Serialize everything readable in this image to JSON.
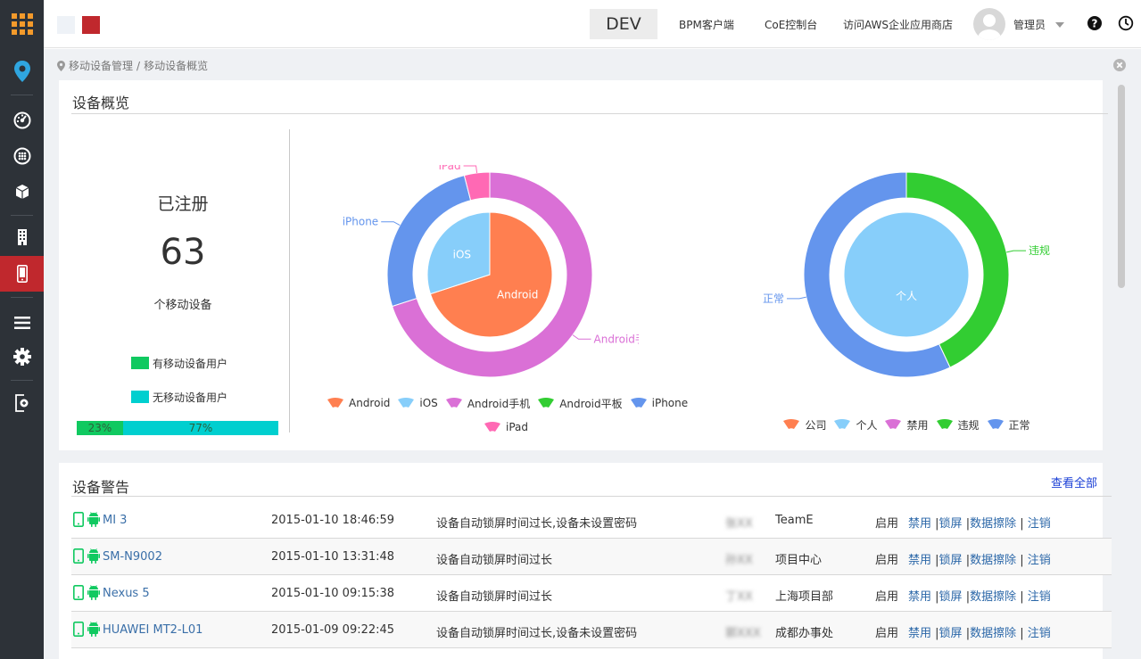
{
  "colors": {
    "sidebar_bg": "#2d3238",
    "sidebar_active": "#c0282d",
    "accent_orange": "#f39a2b",
    "android": "#ff7f50",
    "ios": "#87cefa",
    "android_phone": "#da70d6",
    "android_tablet": "#32cd32",
    "iphone": "#6495ed",
    "ipad": "#ff69b4",
    "green_bar": "#10c960",
    "cyan_bar": "#00cfcf"
  },
  "sidebar": {
    "items": [
      {
        "icon": "location-pin-icon"
      },
      {
        "icon": "dashboard-icon"
      },
      {
        "icon": "globe-grid-icon"
      },
      {
        "icon": "cube-icon"
      },
      {
        "icon": "building-icon"
      },
      {
        "icon": "mobile-device-icon",
        "active": true
      },
      {
        "icon": "menu-lines-icon"
      },
      {
        "icon": "gear-icon"
      },
      {
        "icon": "logout-icon"
      }
    ]
  },
  "topbar": {
    "env": "DEV",
    "links": [
      "BPM客户端",
      "CoE控制台",
      "访问AWS企业应用商店"
    ],
    "username": "管理员",
    "help_icon": "help-circle-icon",
    "clock_icon": "clock-icon"
  },
  "breadcrumb": {
    "parts": [
      "移动设备管理",
      "/",
      "移动设备概览"
    ]
  },
  "overview": {
    "title": "设备概览",
    "registered_label": "已注册",
    "count": "63",
    "unit": "个移动设备",
    "legend": [
      {
        "label": "有移动设备用户",
        "color": "#10c960"
      },
      {
        "label": "无移动设备用户",
        "color": "#00cfcf"
      }
    ],
    "bar": [
      {
        "label": "23%",
        "value": 23,
        "color": "#10c960"
      },
      {
        "label": "77%",
        "value": 77,
        "color": "#00cfcf"
      }
    ]
  },
  "chart_data": [
    {
      "type": "pie",
      "inner_series": [
        {
          "name": "Android",
          "value": 70
        },
        {
          "name": "iOS",
          "value": 30
        }
      ],
      "outer_series": [
        {
          "name": "Android手机",
          "value": 70
        },
        {
          "name": "iPhone",
          "value": 26
        },
        {
          "name": "iPad",
          "value": 4
        }
      ],
      "inner_labels": [
        "Android",
        "iOS"
      ],
      "outer_labels": [
        "Android手机",
        "iPhone",
        "iPad"
      ],
      "legend": [
        "Android",
        "iOS",
        "Android手机",
        "Android平板",
        "iPhone",
        "iPad"
      ]
    },
    {
      "type": "pie",
      "inner_series": [
        {
          "name": "个人",
          "value": 100
        }
      ],
      "outer_series": [
        {
          "name": "违规",
          "value": 43
        },
        {
          "name": "正常",
          "value": 57
        }
      ],
      "inner_labels": [
        "个人"
      ],
      "outer_labels": [
        "违规",
        "正常"
      ],
      "legend": [
        "公司",
        "个人",
        "禁用",
        "违规",
        "正常"
      ]
    }
  ],
  "alerts": {
    "title": "设备警告",
    "view_all": "查看全部",
    "rows": [
      {
        "device": "MI 3",
        "time": "2015-01-10 18:46:59",
        "message": "设备自动锁屏时间过长,设备未设置密码",
        "user": "张XX",
        "dept": "TeamE",
        "status": "启用"
      },
      {
        "device": "SM-N9002",
        "time": "2015-01-10 13:31:48",
        "message": "设备自动锁屏时间过长",
        "user": "孙XX",
        "dept": "项目中心",
        "status": "启用"
      },
      {
        "device": "Nexus 5",
        "time": "2015-01-10 09:15:38",
        "message": "设备自动锁屏时间过长",
        "user": "丁XX",
        "dept": "上海项目部",
        "status": "启用"
      },
      {
        "device": "HUAWEI MT2-L01",
        "time": "2015-01-09 09:22:45",
        "message": "设备自动锁屏时间过长,设备未设置密码",
        "user": "郭XXX",
        "dept": "成都办事处",
        "status": "启用"
      }
    ],
    "actions": [
      "禁用",
      "锁屏",
      "数据擦除",
      "注销"
    ]
  }
}
